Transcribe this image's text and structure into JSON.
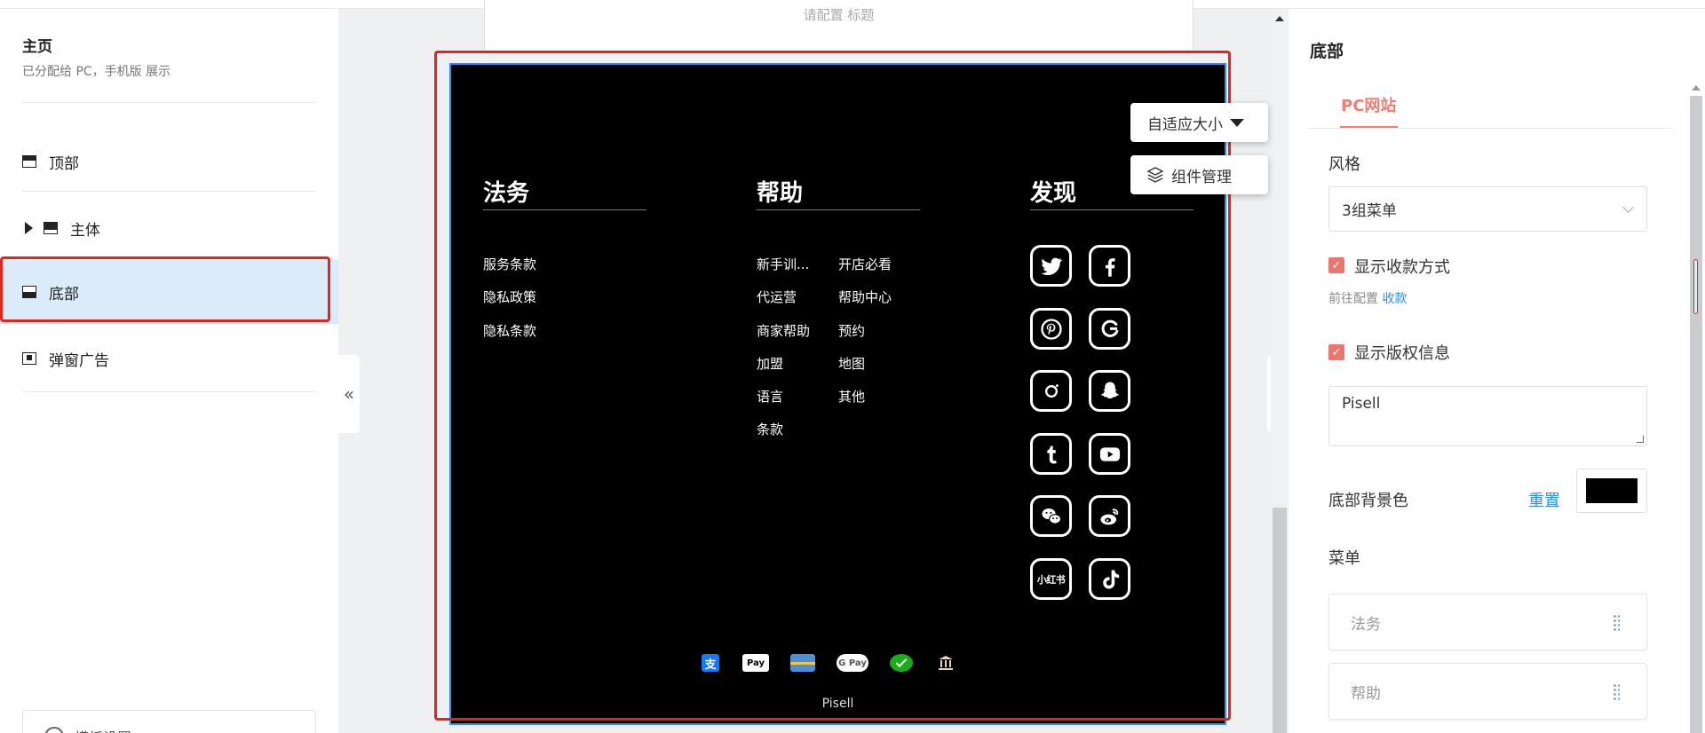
{
  "canvas_header": {
    "placeholder_text": "请配置 标题"
  },
  "left_panel": {
    "title": "主页",
    "subtitle": "已分配给 PC，手机版 展示",
    "items": [
      {
        "label": "顶部"
      },
      {
        "label": "主体"
      },
      {
        "label": "底部"
      },
      {
        "label": "弹窗广告"
      }
    ],
    "template_settings": "模板设置"
  },
  "handles": {
    "left": "«",
    "right": "»"
  },
  "floating": {
    "size_select": "自适应大小",
    "component_manage": "组件管理"
  },
  "footer": {
    "columns": [
      {
        "title": "法务",
        "links": [
          "服务条款",
          "隐私政策",
          "隐私条款"
        ]
      },
      {
        "title": "帮助",
        "links_col1": [
          "新手训...",
          "代运营",
          "商家帮助",
          "加盟",
          "语言",
          "条款"
        ],
        "links_col2": [
          "开店必看",
          "帮助中心",
          "预约",
          "地图",
          "其他"
        ]
      },
      {
        "title": "发现"
      }
    ],
    "social_icons": [
      "twitter-icon",
      "facebook-icon",
      "pinterest-icon",
      "google-icon",
      "instagram-icon",
      "snapchat-icon",
      "tumblr-icon",
      "youtube-icon",
      "wechat-icon",
      "weibo-icon",
      "xiaohongshu-icon",
      "tiktok-icon"
    ],
    "xiaohongshu_text": "小红书",
    "payment_methods": [
      {
        "name": "alipay-icon",
        "label": "支"
      },
      {
        "name": "apple-pay-icon",
        "label": "Pay"
      },
      {
        "name": "card-icon",
        "label": ""
      },
      {
        "name": "google-pay-icon",
        "label": "G Pay"
      },
      {
        "name": "wechat-pay-icon",
        "label": ""
      },
      {
        "name": "bank-icon",
        "label": ""
      }
    ],
    "copyright": "Pisell",
    "background_color": "#000000"
  },
  "right_panel": {
    "title": "底部",
    "tab": "PC网站",
    "style_label": "风格",
    "style_value": "3组菜单",
    "show_payment_label": "显示收款方式",
    "payment_hint_prefix": "前往配置",
    "payment_hint_link": "收款",
    "show_copyright_label": "显示版权信息",
    "copyright_value": "Pisell",
    "bg_color_label": "底部背景色",
    "reset_label": "重置",
    "bg_color": "#000000",
    "menu_label": "菜单",
    "menu_items": [
      "法务",
      "帮助"
    ]
  },
  "colors": {
    "accent": "#f07c72",
    "link": "#2f8cff",
    "highlight_border": "#e0241f",
    "selected_bg": "#dcebfa"
  }
}
